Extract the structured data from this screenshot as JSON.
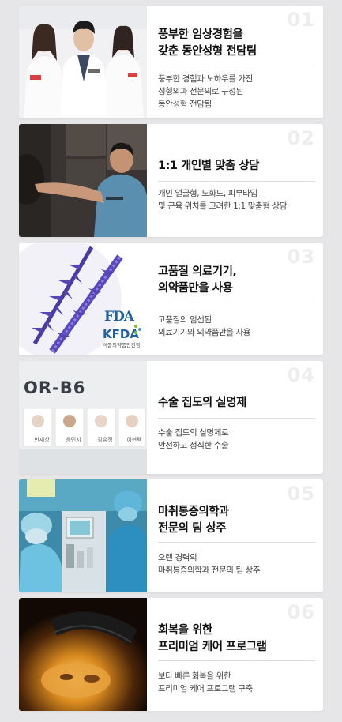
{
  "features": [
    {
      "number": "01",
      "title": "풍부한 임상경험을\n갖춘 동안성형 전담팀",
      "description": "풍부한 경험과 노하우를 가진\n성형외과 전문의로 구성된\n동안성형 전담팀",
      "image": "doctors-team-photo"
    },
    {
      "number": "02",
      "title": "1:1 개인별 맞춤 상담",
      "description": "개인 얼굴형, 노화도, 피부타입\n및 근육 위치를 고려한 1:1 맞춤형 상담",
      "image": "consultation-photo"
    },
    {
      "number": "03",
      "title": "고품질 의료기기,\n의약품만을 사용",
      "description": "고품질의 엄선된\n의료기기와 의약품만을 사용",
      "image": "thread-device-photo",
      "logos": {
        "fda": "FDA",
        "kfda": "KFDA",
        "kfda_caption": "식품의약품안전청"
      }
    },
    {
      "number": "04",
      "title": "수술 집도의 실명제",
      "description": "수술 집도의 실명제로\n안전하고 정직한 수술",
      "image": "operating-room-sign-photo",
      "sign": {
        "room": "OR-B6",
        "names": [
          "반재상",
          "윤민지",
          "김유정",
          "이현택"
        ]
      }
    },
    {
      "number": "05",
      "title": "마취통증의학과\n전문의 팀 상주",
      "description": "오랜 경력의\n마취통증의학과 전문의 팀 상주",
      "image": "anesthesia-team-photo"
    },
    {
      "number": "06",
      "title": "회복을 위한\n프리미엄 케어 프로그램",
      "description": "보다 빠른 회복을 위한\n프리미엄 케어 프로그램 구축",
      "image": "led-care-photo"
    }
  ],
  "colors": {
    "background": "#e6e6e8",
    "card": "#ffffff",
    "number": "#ededed",
    "title": "#111111",
    "description": "#444444"
  }
}
